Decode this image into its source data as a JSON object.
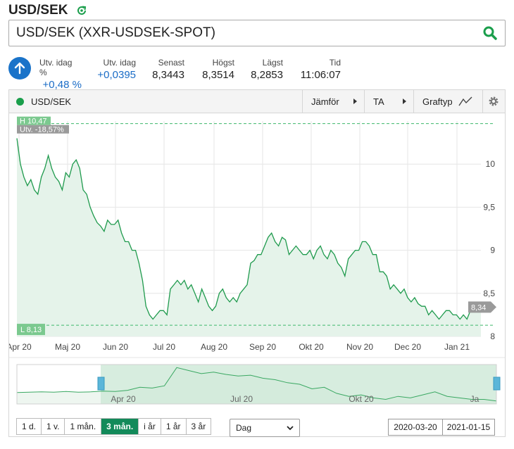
{
  "header": {
    "title": "USD/SEK"
  },
  "search": {
    "value": "USD/SEK (XXR-USDSEK-SPOT)"
  },
  "stats": [
    {
      "label": "Utv. idag %",
      "value": "+0,48 %",
      "positive": true
    },
    {
      "label": "Utv. idag",
      "value": "+0,0395",
      "positive": true
    },
    {
      "label": "Senast",
      "value": "8,3443",
      "positive": false
    },
    {
      "label": "Högst",
      "value": "8,3514",
      "positive": false
    },
    {
      "label": "Lägst",
      "value": "8,2853",
      "positive": false
    },
    {
      "label": "Tid",
      "value": "11:06:07",
      "positive": false
    }
  ],
  "toolbar": {
    "series_name": "USD/SEK",
    "compare_label": "Jämför",
    "ta_label": "TA",
    "charttype_label": "Graftyp"
  },
  "colors": {
    "accent": "#1a9e4b",
    "line": "#1f9a4d",
    "fill": "#e5f3ea",
    "up_button": "#1a73c9",
    "active_period": "#138a5a"
  },
  "chart_data": {
    "type": "area",
    "series_name": "USD/SEK",
    "x_ticks": [
      "Apr 20",
      "Maj 20",
      "Jun 20",
      "Jul 20",
      "Aug 20",
      "Sep 20",
      "Okt 20",
      "Nov 20",
      "Dec 20",
      "Jan 21"
    ],
    "y_ticks": [
      "10",
      "9,5",
      "9",
      "8,5",
      "8"
    ],
    "ylim": [
      8.0,
      10.5
    ],
    "high_label": "H 10,47",
    "low_label": "L 8,13",
    "change_label": "Utv. -18,57%",
    "last_label": "8,34",
    "high": 10.47,
    "low": 8.13,
    "values": [
      10.3,
      10.0,
      9.85,
      9.75,
      9.82,
      9.7,
      9.65,
      9.85,
      9.95,
      10.1,
      9.95,
      9.85,
      9.8,
      9.7,
      9.9,
      9.85,
      10.0,
      10.05,
      9.95,
      9.7,
      9.65,
      9.5,
      9.4,
      9.32,
      9.28,
      9.22,
      9.35,
      9.3,
      9.3,
      9.35,
      9.2,
      9.1,
      9.1,
      9.0,
      9.0,
      8.85,
      8.65,
      8.35,
      8.25,
      8.2,
      8.25,
      8.3,
      8.3,
      8.25,
      8.55,
      8.6,
      8.65,
      8.6,
      8.65,
      8.55,
      8.6,
      8.5,
      8.4,
      8.55,
      8.45,
      8.35,
      8.3,
      8.35,
      8.5,
      8.55,
      8.45,
      8.4,
      8.45,
      8.4,
      8.5,
      8.55,
      8.6,
      8.85,
      8.88,
      8.95,
      8.95,
      9.05,
      9.15,
      9.2,
      9.1,
      9.05,
      9.15,
      9.12,
      8.95,
      9.0,
      9.05,
      9.0,
      8.95,
      8.95,
      9.0,
      8.9,
      9.0,
      9.05,
      8.95,
      8.9,
      9.0,
      8.95,
      8.85,
      8.8,
      8.7,
      8.9,
      8.95,
      9.0,
      9.0,
      9.1,
      9.1,
      9.05,
      8.95,
      8.95,
      8.75,
      8.75,
      8.7,
      8.55,
      8.6,
      8.55,
      8.5,
      8.55,
      8.45,
      8.4,
      8.45,
      8.38,
      8.35,
      8.35,
      8.25,
      8.3,
      8.25,
      8.2,
      8.25,
      8.3,
      8.3,
      8.25,
      8.25,
      8.2,
      8.25,
      8.2,
      8.3,
      8.35,
      8.3,
      8.34
    ],
    "navigator_ticks": [
      "Apr 20",
      "Jul 20",
      "Okt 20",
      "Ja"
    ]
  },
  "periods": [
    {
      "label": "1 d.",
      "active": false
    },
    {
      "label": "1 v.",
      "active": false
    },
    {
      "label": "1 mån.",
      "active": false
    },
    {
      "label": "3 mån.",
      "active": true
    },
    {
      "label": "i år",
      "active": false
    },
    {
      "label": "1 år",
      "active": false
    },
    {
      "label": "3 år",
      "active": false
    }
  ],
  "interval": {
    "selected": "Dag"
  },
  "date_range": {
    "from": "2020-03-20",
    "to": "2021-01-15"
  }
}
